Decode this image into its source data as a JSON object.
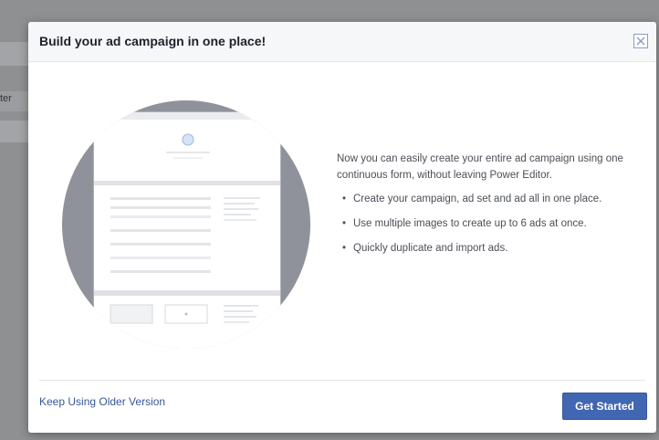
{
  "background": {
    "side_text": "ter"
  },
  "modal": {
    "title": "Build your ad campaign in one place!",
    "close_icon": "close-icon",
    "intro": "Now you can easily create your entire ad campaign using one continuous form, without leaving Power Editor.",
    "bullet_glyph": "•",
    "bullets": [
      "Create your campaign, ad set and ad all in one place.",
      "Use multiple images to create up to 6 ads at once.",
      "Quickly duplicate and import ads."
    ],
    "footer": {
      "older_link": "Keep Using Older Version",
      "get_started": "Get Started"
    }
  },
  "colors": {
    "accent": "#4267b2",
    "link": "#365899",
    "circle": "#8f929a"
  }
}
